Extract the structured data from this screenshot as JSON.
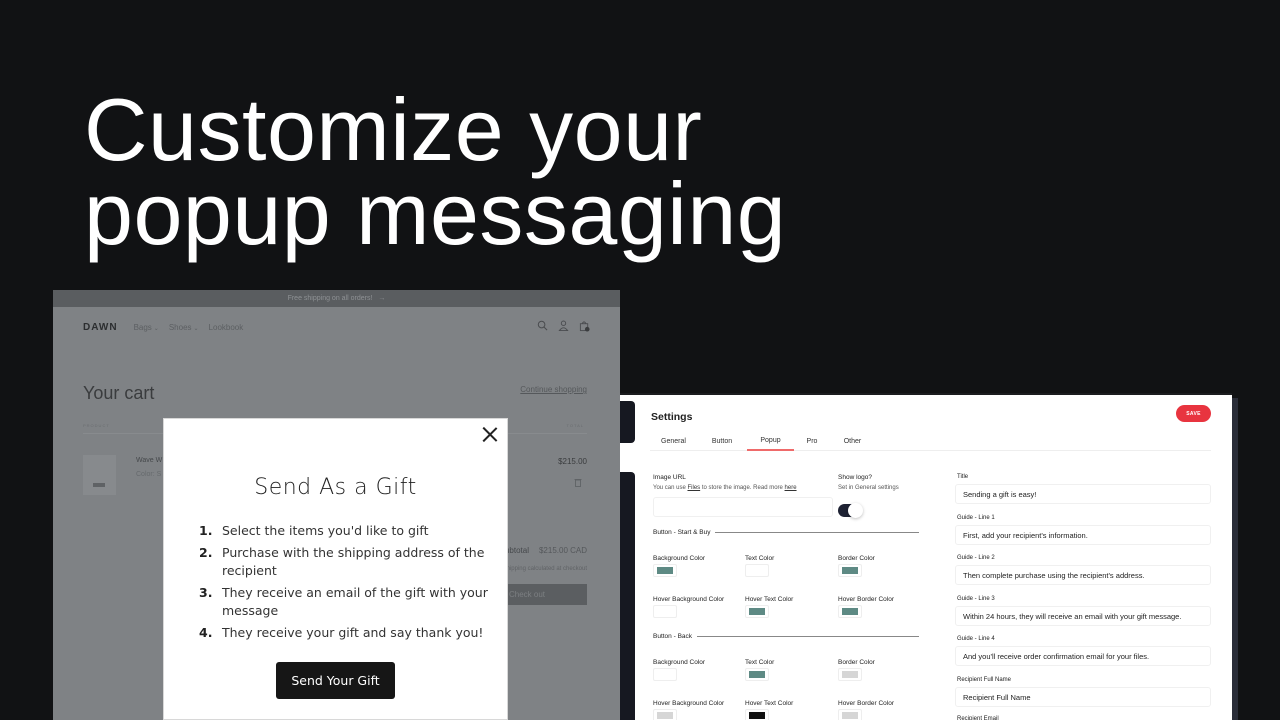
{
  "hero": {
    "line1": "Customize your",
    "line2": "popup messaging"
  },
  "store": {
    "announcement": "Free shipping on all orders!",
    "logo": "DAWN",
    "nav": [
      "Bags",
      "Shoes",
      "Lookbook"
    ],
    "cart_title": "Your cart",
    "continue_shopping": "Continue shopping",
    "col_product": "PRODUCT",
    "col_total": "TOTAL",
    "item": {
      "name": "Wave W",
      "color": "Color: S",
      "price": "$215.00"
    },
    "subtotal_label": "Subtotal",
    "subtotal_amount": "$215.00 CAD",
    "tax_note": "Taxes and shipping calculated at checkout",
    "checkout_label": "Check out"
  },
  "popup": {
    "title": "Send As a Gift",
    "steps": [
      {
        "num": "1.",
        "text": "Select the items you'd like to gift"
      },
      {
        "num": "2.",
        "text": "Purchase with the shipping address of the recipient"
      },
      {
        "num": "3.",
        "text": "They receive an email of the gift with your message"
      },
      {
        "num": "4.",
        "text": "They receive your gift and say thank you!"
      }
    ],
    "button_label": "Send Your Gift"
  },
  "settings": {
    "title": "Settings",
    "save_label": "SAVE",
    "tabs": [
      "General",
      "Button",
      "Popup",
      "Pro",
      "Other"
    ],
    "active_tab": "Popup",
    "image_url": {
      "label": "Image URL",
      "help_prefix": "You can use ",
      "help_link1": "Files",
      "help_mid": " to store the image. Read more ",
      "help_link2": "here",
      "value": ""
    },
    "show_logo": {
      "label": "Show logo?",
      "help": "Set in General settings",
      "enabled": true
    },
    "section_start": "Button - Start & Buy",
    "section_back": "Button - Back",
    "start_colors": [
      {
        "label": "Background Color",
        "color": "#5e8a84"
      },
      {
        "label": "Text Color",
        "color": "#ffffff"
      },
      {
        "label": "Border Color",
        "color": "#5e8a84"
      },
      {
        "label": "Hover Background Color",
        "color": "#ffffff"
      },
      {
        "label": "Hover Text Color",
        "color": "#5e8a84"
      },
      {
        "label": "Hover Border Color",
        "color": "#5e8a84"
      }
    ],
    "back_colors": [
      {
        "label": "Background Color",
        "color": "#ffffff"
      },
      {
        "label": "Text Color",
        "color": "#5e8a84"
      },
      {
        "label": "Border Color",
        "color": "#d6d6d6"
      },
      {
        "label": "Hover Background Color",
        "color": "#d6d6d6"
      },
      {
        "label": "Hover Text Color",
        "color": "#111111"
      },
      {
        "label": "Hover Border Color",
        "color": "#d6d6d6"
      }
    ],
    "fields": [
      {
        "label": "Title",
        "value": "Sending a gift is easy!"
      },
      {
        "label": "Guide - Line 1",
        "value": "First, add your recipient's information."
      },
      {
        "label": "Guide - Line 2",
        "value": "Then complete purchase using the recipient's address."
      },
      {
        "label": "Guide - Line 3",
        "value": "Within 24 hours, they will receive an email with your gift message."
      },
      {
        "label": "Guide - Line 4",
        "value": "And you'll receive order confirmation email for your files."
      },
      {
        "label": "Recipient Full Name",
        "value": "Recipient Full Name"
      },
      {
        "label": "Recipient Email",
        "value": ""
      }
    ]
  },
  "colors": {
    "background": "#111214",
    "accent_red": "#e8343f",
    "teal": "#5e8a84"
  }
}
